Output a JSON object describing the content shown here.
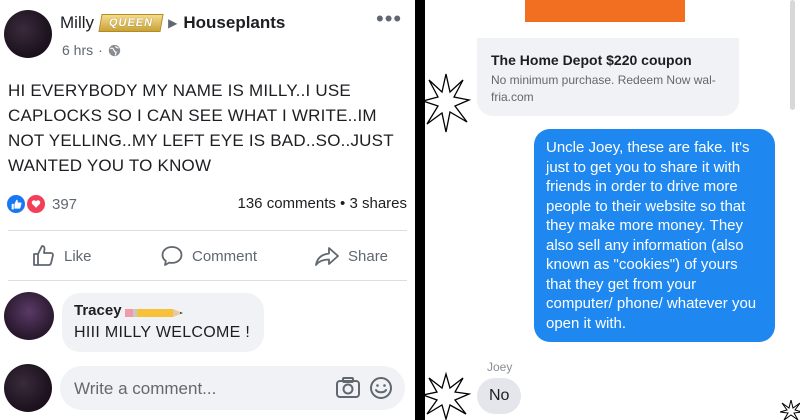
{
  "post": {
    "author": "Milly",
    "badge": "QUEEN",
    "group": "Houseplants",
    "time": "6 hrs",
    "body": "HI EVERYBODY MY NAME IS MILLY..I USE CAPLOCKS SO I CAN SEE WHAT I WRITE..IM NOT YELLING..MY LEFT EYE IS BAD..SO..JUST WANTED YOU TO KNOW",
    "reaction_count": "397",
    "comments_shares": "136 comments • 3 shares",
    "actions": {
      "like": "Like",
      "comment": "Comment",
      "share": "Share"
    },
    "reply": {
      "name": "Tracey",
      "text": "HIII MILLY WELCOME !"
    },
    "write_placeholder": "Write a comment...",
    "colors": {
      "link_blue": "#1877f2",
      "love_red": "#f33e58",
      "text": "#1c1e21",
      "muted": "#606770"
    }
  },
  "messenger": {
    "coupon_title": "The Home Depot $220 coupon",
    "coupon_subtitle": "No minimum purchase. Redeem Now wal-fria.com",
    "message": "Uncle Joey, these are fake. It's just to get you to share it with friends in order to drive more people to their website so that they make more money. They also sell any information (also known as \"cookies\") of yours that they get from your computer/ phone/ whatever you open it with.",
    "sender": "Joey",
    "reply": "No",
    "colors": {
      "bubble_blue": "#1e88f0",
      "home_depot_orange": "#f26f21"
    }
  }
}
